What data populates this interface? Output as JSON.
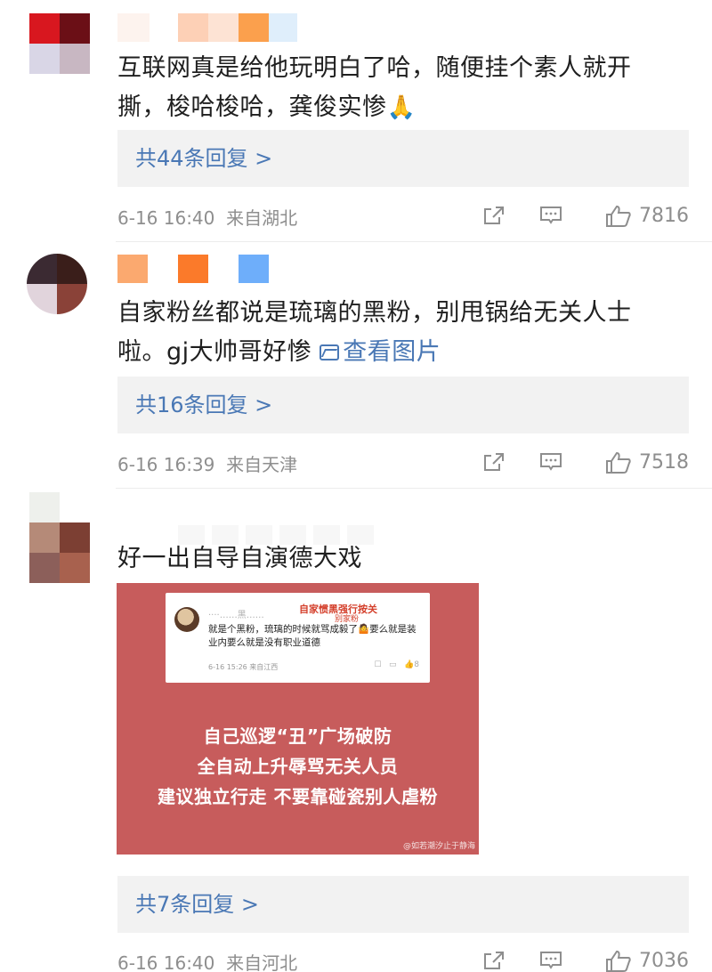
{
  "comments": [
    {
      "text": "互联网真是给他玩明白了哈，随便挂个素人就开撕，梭哈梭哈，龚俊实惨",
      "emoji": "🙏",
      "replies_label": "共44条回复 >",
      "time": "6-16 16:40",
      "location": "来自湖北",
      "likes": "7816"
    },
    {
      "text": "自家粉丝都说是琉璃的黑粉，别甩锅给无关人士啦。gj大帅哥好惨",
      "view_pic_label": "查看图片",
      "replies_label": "共16条回复 >",
      "time": "6-16 16:39",
      "location": "来自天津",
      "likes": "7518"
    },
    {
      "text": "好一出自导自演德大戏",
      "image": {
        "card_name": "····……黑……",
        "card_tag": "自家惯黑强行按关",
        "card_tag2": "别家粉",
        "card_text_1": "就是个黑粉，琉璃的时候就骂成毅了",
        "card_text_emoji": "🤷",
        "card_text_2": "要么就是装业内要么就是没有职业道德",
        "card_meta": "6-16 15:26 来自江西",
        "card_like": "8",
        "lines": [
          "自己巡逻“丑”广场破防",
          "全自动上升辱骂无关人员",
          "建议独立行走 不要靠碰瓷别人虐粉"
        ],
        "watermark": "@如若潮汐止于静海"
      },
      "replies_label": "共7条回复 >",
      "time": "6-16 16:40",
      "location": "来自河北",
      "likes": "7036"
    }
  ],
  "icons": {
    "share": "share-icon",
    "comment": "comment-icon",
    "like": "thumbs-up-icon"
  }
}
